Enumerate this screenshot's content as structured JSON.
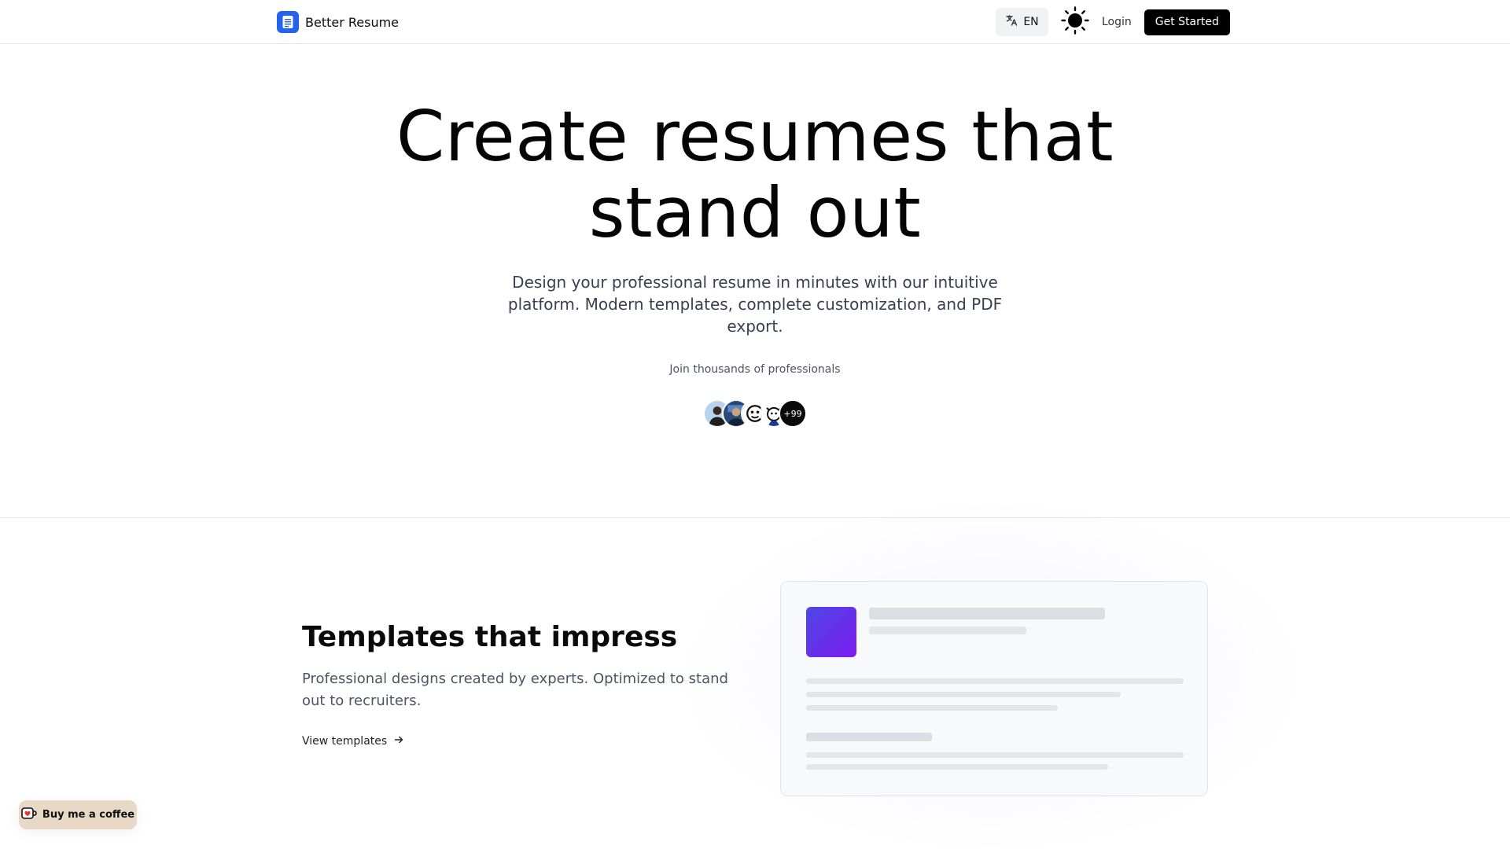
{
  "header": {
    "brand_name": "Better Resume",
    "language_label": "EN",
    "login_label": "Login",
    "cta_label": "Get Started"
  },
  "hero": {
    "title_line1": "Create resumes that",
    "title_line2": "stand out",
    "subtitle": "Design your professional resume in minutes with our intuitive platform. Modern templates, complete customization, and PDF export.",
    "social_proof": "Join thousands of professionals",
    "avatars_more_label": "+99"
  },
  "feature": {
    "title": "Templates that impress",
    "description": "Professional designs created by experts. Optimized to stand out to recruiters.",
    "link_label": "View templates"
  },
  "coffee": {
    "label": "Buy me a coffee"
  },
  "colors": {
    "brand": "#2563eb",
    "cta_background": "#000000",
    "mock_gradient_start": "#4f46e5",
    "mock_gradient_end": "#7c1cf0",
    "coffee_background": "#e8d8c6"
  },
  "icons": {
    "logo": "document-icon",
    "language": "translate-icon",
    "theme": "sun-icon",
    "link_arrow": "arrow-right-icon",
    "coffee": "coffee-cup-icon"
  }
}
